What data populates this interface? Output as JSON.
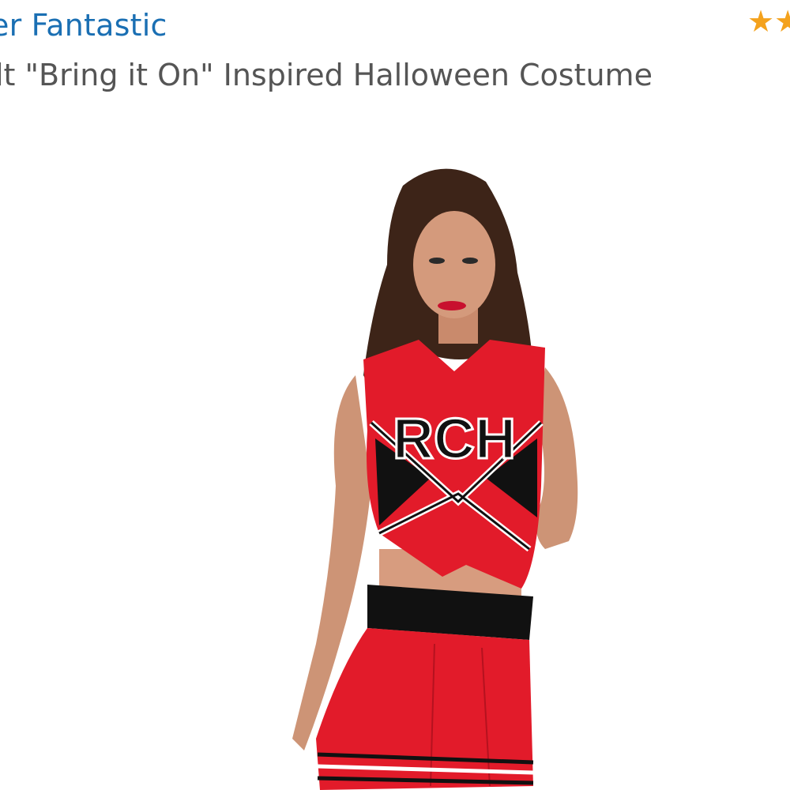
{
  "product": {
    "brand": "er Fantastic",
    "title": "lt \"Bring it On\" Inspired Halloween Costume",
    "rating_stars": "★★",
    "image": {
      "jersey_letters": "RCH",
      "primary_color": "#e21b2a",
      "secondary_color": "#111111",
      "trim_color": "#ffffff"
    }
  }
}
